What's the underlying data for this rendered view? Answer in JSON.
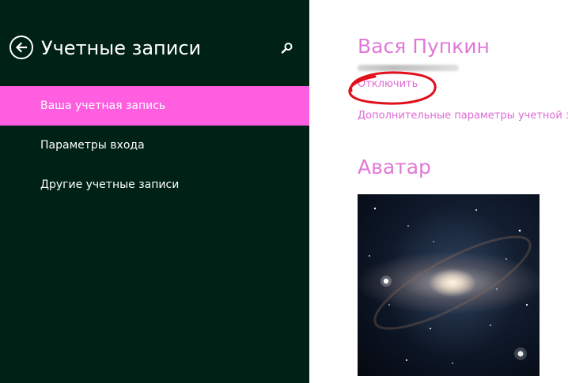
{
  "sidebar": {
    "title": "Учетные записи",
    "back_icon": "back-arrow-icon",
    "search_icon": "search-icon",
    "items": [
      {
        "label": "Ваша учетная запись",
        "selected": true
      },
      {
        "label": "Параметры входа",
        "selected": false
      },
      {
        "label": "Другие учетные записи",
        "selected": false
      }
    ]
  },
  "account": {
    "name": "Вася Пупкин",
    "disconnect_label": "Отключить",
    "advanced_label": "Дополнительные параметры учетной записи"
  },
  "avatar": {
    "heading": "Аватар",
    "image": "galaxy-image"
  },
  "colors": {
    "sidebar_bg": "#002116",
    "accent": "#ff5ee0",
    "link": "#e068d6",
    "annotation": "#e0101c"
  }
}
